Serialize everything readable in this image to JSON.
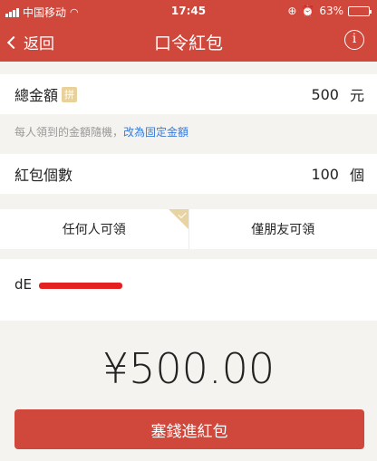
{
  "status_bar": {
    "carrier": "中国移动",
    "time": "17:45",
    "battery": "63%",
    "battery_level": 0.63
  },
  "nav": {
    "back_label": "返回",
    "title": "口令紅包",
    "info_symbol": "i"
  },
  "amount_row": {
    "label": "總金額",
    "badge": "拼",
    "value": "500",
    "unit": "元"
  },
  "hint": {
    "text": "每人領到的金額隨機，",
    "link": "改為固定金額"
  },
  "count_row": {
    "label": "紅包個數",
    "value": "100",
    "unit": "個"
  },
  "visibility": {
    "options": [
      "任何人可領",
      "僅朋友可領"
    ],
    "selected": 0
  },
  "password": {
    "text": "dE"
  },
  "total": "¥500.00",
  "submit_label": "塞錢進紅包",
  "colors": {
    "brand_red": "#d0473b",
    "link_blue": "#3a7bd5",
    "gold": "#e9d19c"
  }
}
